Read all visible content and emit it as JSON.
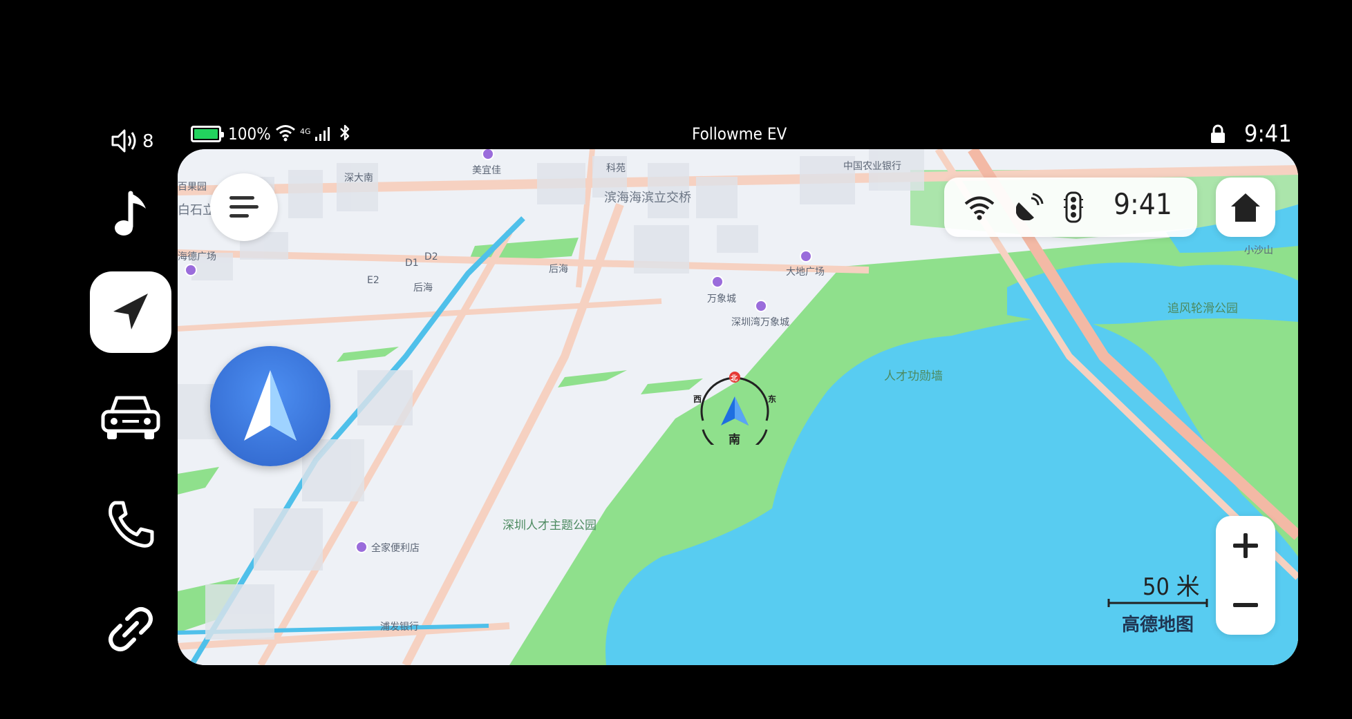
{
  "status_bar": {
    "volume_level": "8",
    "battery_percent": "100%",
    "battery_level": 1.0,
    "network_type": "4G",
    "title": "Followme EV",
    "time": "9:41"
  },
  "rail": {
    "items": [
      {
        "name": "music",
        "icon": "music-note-icon",
        "active": false
      },
      {
        "name": "navigation",
        "icon": "navigation-arrow-icon",
        "active": true
      },
      {
        "name": "vehicle",
        "icon": "car-icon",
        "active": false
      },
      {
        "name": "phone",
        "icon": "phone-icon",
        "active": false
      },
      {
        "name": "link",
        "icon": "link-icon",
        "active": false
      }
    ]
  },
  "map": {
    "info_time": "9:41",
    "compass": {
      "north": "北",
      "west": "西",
      "east": "东",
      "south": "南"
    },
    "scale": "50 米",
    "brand": "高德地图",
    "labels": {
      "meiyijia": "美宜佳",
      "keyuan": "科苑",
      "agri_bank": "中国农业银行",
      "baiguoyuan": "百果园",
      "shenda_nan": "深大南",
      "baishili": "白石立",
      "interchange": "滨海海滨立交桥",
      "haide_plaza": "海德广场",
      "d1": "D1",
      "d2": "D2",
      "e2": "E2",
      "houhai1": "后海",
      "houhai2": "后海",
      "wanxiangcheng": "万象城",
      "shenzhen_bay_mixc": "深圳湾万象城",
      "dadi_plaza": "大地广场",
      "xiaoshashan": "小沙山",
      "zhuifeng_park": "追风轮滑公园",
      "talent_pier": "人才功勋墙",
      "talent_park": "深圳人才主题公园",
      "family_mart": "全家便利店",
      "spd_bank": "浦发银行"
    }
  },
  "colors": {
    "water": "#58ccf1",
    "park": "#8fe08c",
    "land": "#eef1f6",
    "road": "#f6d1c1",
    "metro": "#4fc0ea",
    "accent": "#2e6fd9",
    "battery": "#22d35e"
  }
}
